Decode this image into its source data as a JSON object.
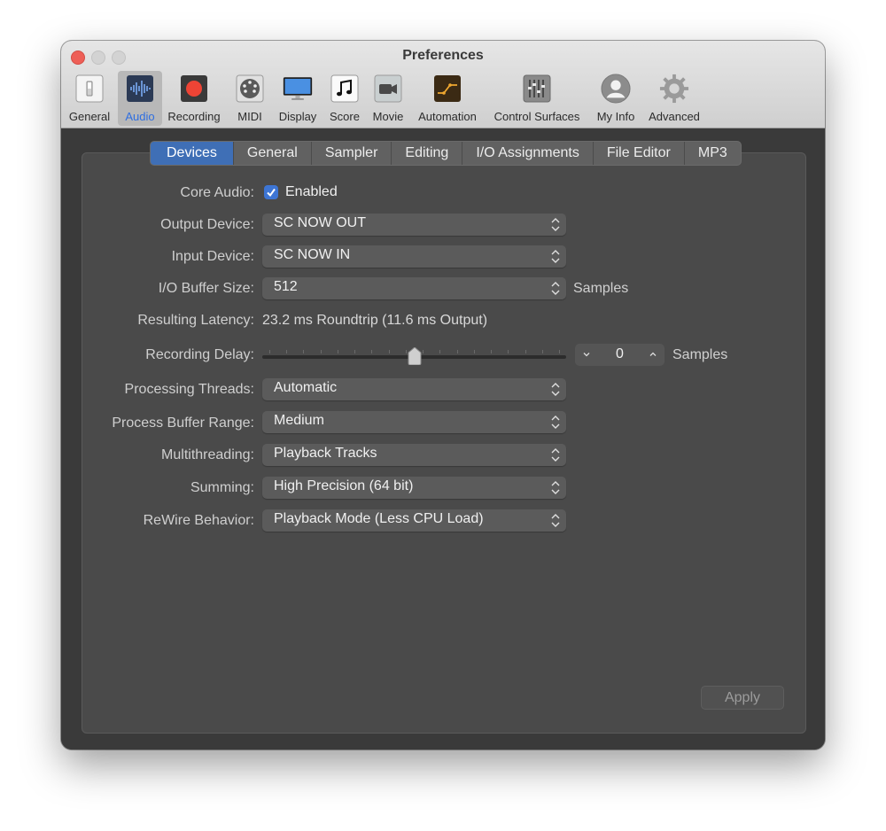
{
  "window": {
    "title": "Preferences"
  },
  "toolbar": {
    "items": [
      {
        "label": "General",
        "icon": "general-switch-icon"
      },
      {
        "label": "Audio",
        "icon": "audio-waveform-icon",
        "active": true
      },
      {
        "label": "Recording",
        "icon": "record-icon"
      },
      {
        "label": "MIDI",
        "icon": "midi-connector-icon"
      },
      {
        "label": "Display",
        "icon": "display-monitor-icon"
      },
      {
        "label": "Score",
        "icon": "music-note-icon"
      },
      {
        "label": "Movie",
        "icon": "video-camera-icon"
      },
      {
        "label": "Automation",
        "icon": "automation-curve-icon"
      },
      {
        "label": "Control Surfaces",
        "icon": "control-surfaces-icon"
      },
      {
        "label": "My Info",
        "icon": "user-avatar-icon"
      },
      {
        "label": "Advanced",
        "icon": "gear-icon"
      }
    ]
  },
  "tabs": [
    "Devices",
    "General",
    "Sampler",
    "Editing",
    "I/O Assignments",
    "File Editor",
    "MP3"
  ],
  "active_tab": "Devices",
  "fields": {
    "core_audio": {
      "label": "Core Audio:",
      "checkbox_label": "Enabled",
      "checked": true
    },
    "output_device": {
      "label": "Output Device:",
      "value": "SC NOW OUT"
    },
    "input_device": {
      "label": "Input Device:",
      "value": "SC NOW IN"
    },
    "io_buffer": {
      "label": "I/O Buffer Size:",
      "value": "512",
      "unit": "Samples"
    },
    "latency": {
      "label": "Resulting Latency:",
      "value": "23.2 ms Roundtrip (11.6 ms Output)"
    },
    "recording_delay": {
      "label": "Recording Delay:",
      "value": "0",
      "unit": "Samples",
      "slider_position": 0.5
    },
    "processing_threads": {
      "label": "Processing Threads:",
      "value": "Automatic"
    },
    "process_buffer_range": {
      "label": "Process Buffer Range:",
      "value": "Medium"
    },
    "multithreading": {
      "label": "Multithreading:",
      "value": "Playback Tracks"
    },
    "summing": {
      "label": "Summing:",
      "value": "High Precision (64 bit)"
    },
    "rewire": {
      "label": "ReWire Behavior:",
      "value": "Playback Mode (Less CPU Load)"
    }
  },
  "buttons": {
    "apply": "Apply"
  },
  "colors": {
    "accent": "#3f6fb6",
    "record_red": "#ee4435"
  }
}
